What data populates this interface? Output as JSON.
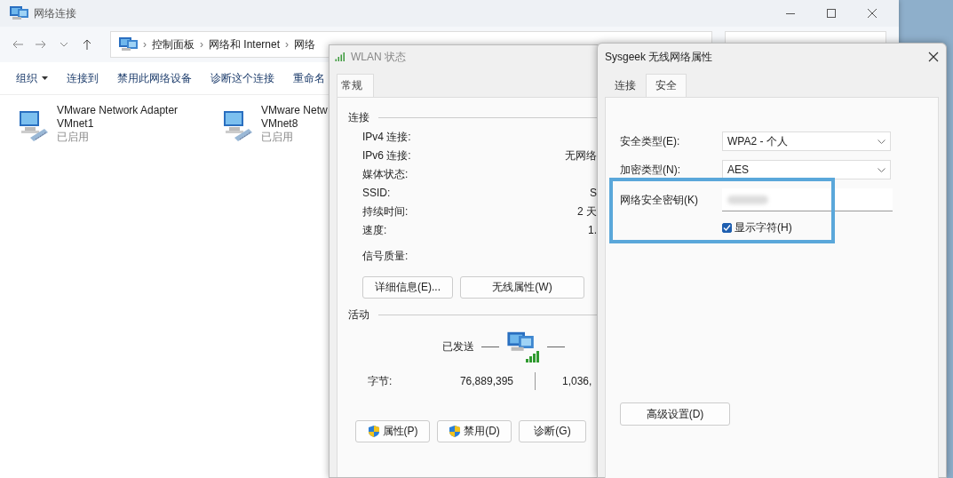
{
  "explorer": {
    "title": "网络连接",
    "breadcrumb": [
      {
        "separator": "›",
        "label": "控制面板"
      },
      {
        "separator": "›",
        "label": "网络和 Internet"
      },
      {
        "separator": "›",
        "label": "网络"
      }
    ],
    "commands": [
      {
        "label": "组织",
        "kind": "menu"
      },
      {
        "label": "连接到",
        "kind": "plain"
      },
      {
        "label": "禁用此网络设备",
        "kind": "plain"
      },
      {
        "label": "诊断这个连接",
        "kind": "plain"
      },
      {
        "label": "重命名",
        "kind": "plain"
      }
    ],
    "adapters": [
      {
        "name": "VMware Network Adapter",
        "device": "VMnet1",
        "status": "已启用"
      },
      {
        "name": "VMware Netw",
        "device": "VMnet8",
        "status": "已启用"
      }
    ]
  },
  "wlan_status": {
    "title": "WLAN 状态",
    "tabs": [
      {
        "label": "常规",
        "selected": true
      }
    ],
    "connection_heading": "连接",
    "rows": [
      {
        "label": "IPv4 连接:"
      },
      {
        "label": "IPv6 连接:",
        "value": "无网络"
      },
      {
        "label": "媒体状态:"
      },
      {
        "label": "SSID:",
        "value": "S"
      },
      {
        "label": "持续时间:",
        "value": "2 天"
      },
      {
        "label": "速度:",
        "value": "1."
      }
    ],
    "signal_label": "信号质量:",
    "buttons": [
      "详细信息(E)...",
      "无线属性(W)"
    ],
    "activity_heading": "活动",
    "sent_label": "已发送",
    "bytes_label": "字节:",
    "bytes_sent": "76,889,395",
    "bytes_received": "1,036,",
    "bottom_buttons": [
      {
        "label": "属性(P)",
        "shield": true
      },
      {
        "label": "禁用(D)",
        "shield": true
      },
      {
        "label": "诊断(G)",
        "shield": false
      }
    ]
  },
  "wireless_properties": {
    "title": "Sysgeek 无线网络属性",
    "tabs": [
      {
        "label": "连接",
        "selected": false
      },
      {
        "label": "安全",
        "selected": true
      }
    ],
    "security_type": {
      "label": "安全类型(E):",
      "value": "WPA2 - 个人"
    },
    "encryption_type": {
      "label": "加密类型(N):",
      "value": "AES"
    },
    "key_label": "网络安全密钥(K)",
    "show_characters": {
      "label": "显示字符(H)",
      "checked": true
    },
    "advanced_button": "高级设置(D)"
  }
}
